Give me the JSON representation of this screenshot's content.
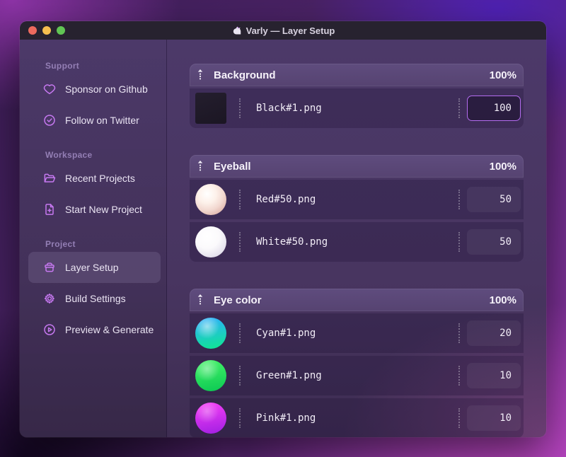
{
  "window": {
    "title": "Varly — Layer Setup",
    "traffic_lights": [
      {
        "name": "close",
        "color": "#ec6a5e"
      },
      {
        "name": "minimize",
        "color": "#f5bf4f"
      },
      {
        "name": "zoom",
        "color": "#61c554"
      }
    ]
  },
  "sidebar": {
    "sections": [
      {
        "label": "Support",
        "items": [
          {
            "label": "Sponsor on Github",
            "icon": "heart-icon",
            "selected": false
          },
          {
            "label": "Follow on Twitter",
            "icon": "badge-check-icon",
            "selected": false
          }
        ]
      },
      {
        "label": "Workspace",
        "items": [
          {
            "label": "Recent Projects",
            "icon": "folder-open-icon",
            "selected": false
          },
          {
            "label": "Start New Project",
            "icon": "file-plus-icon",
            "selected": false
          }
        ]
      },
      {
        "label": "Project",
        "items": [
          {
            "label": "Layer Setup",
            "icon": "layers-box-icon",
            "selected": true
          },
          {
            "label": "Build Settings",
            "icon": "gear-icon",
            "selected": false
          },
          {
            "label": "Preview & Generate",
            "icon": "play-circle-icon",
            "selected": false
          }
        ]
      }
    ]
  },
  "layers": {
    "groups": [
      {
        "name": "Background",
        "opacity": "100%",
        "items": [
          {
            "file": "Black#1.png",
            "weight": "100",
            "thumb": "black-square",
            "focused": true
          }
        ]
      },
      {
        "name": "Eyeball",
        "opacity": "100%",
        "items": [
          {
            "file": "Red#50.png",
            "weight": "50",
            "thumb": "red-ball",
            "focused": false
          },
          {
            "file": "White#50.png",
            "weight": "50",
            "thumb": "white-ball",
            "focused": false
          }
        ]
      },
      {
        "name": "Eye color",
        "opacity": "100%",
        "items": [
          {
            "file": "Cyan#1.png",
            "weight": "20",
            "thumb": "cyan-ball",
            "focused": false
          },
          {
            "file": "Green#1.png",
            "weight": "10",
            "thumb": "green-ball",
            "focused": false
          },
          {
            "file": "Pink#1.png",
            "weight": "10",
            "thumb": "pink-ball",
            "focused": false
          }
        ]
      }
    ]
  },
  "colors": {
    "accent_icon": "#c678f0",
    "focus_border": "#b46cf0",
    "group_header_bg": "#5a4777",
    "titlebar_bg": "#27222f"
  }
}
